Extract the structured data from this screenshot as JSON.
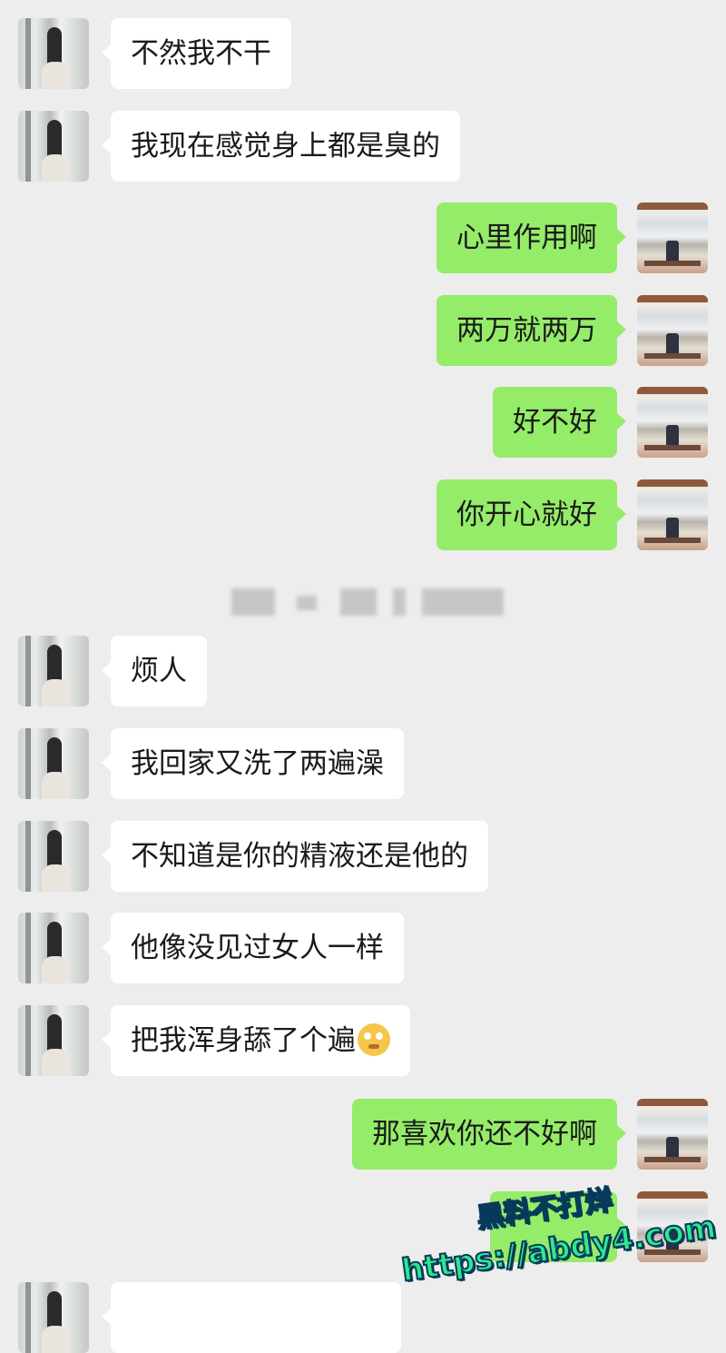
{
  "messages": [
    {
      "side": "her",
      "text": "不然我不干"
    },
    {
      "side": "her",
      "text": "我现在感觉身上都是臭的"
    },
    {
      "side": "me",
      "text": "心里作用啊"
    },
    {
      "side": "me",
      "text": "两万就两万"
    },
    {
      "side": "me",
      "text": "好不好"
    },
    {
      "side": "me",
      "text": "你开心就好"
    },
    {
      "side": "her",
      "text": "烦人"
    },
    {
      "side": "her",
      "text": "我回家又洗了两遍澡"
    },
    {
      "side": "her",
      "text": "不知道是你的精液还是他的"
    },
    {
      "side": "her",
      "text": "他像没见过女人一样"
    },
    {
      "side": "her",
      "text": "把我浑身舔了个遍",
      "emoji": "drooling-face-emoji"
    },
    {
      "side": "me",
      "text": "那喜欢你还不好啊"
    }
  ],
  "watermark": {
    "line1": "黑料不打烊",
    "line2": "https://abdy4.com"
  },
  "colors": {
    "background": "#ededed",
    "her_bubble": "#ffffff",
    "my_bubble": "#95ec69",
    "watermark": "#2ee88d"
  }
}
